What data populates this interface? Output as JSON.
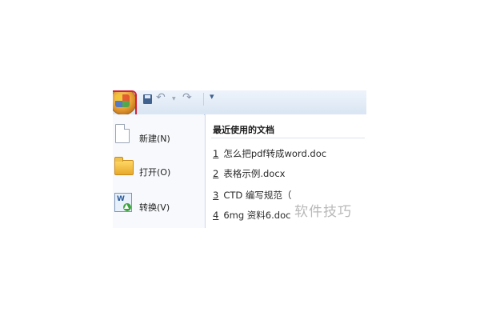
{
  "menu": {
    "items": [
      {
        "label": "新建(N)",
        "icon": "new-document-icon"
      },
      {
        "label": "打开(O)",
        "icon": "open-folder-icon"
      },
      {
        "label": "转换(V)",
        "icon": "convert-icon"
      }
    ]
  },
  "recent": {
    "title": "最近使用的文档",
    "items": [
      {
        "num": "1",
        "name": "怎么把pdf转成word.doc"
      },
      {
        "num": "2",
        "name": "表格示例.docx"
      },
      {
        "num": "3",
        "name": "CTD 编写规范（"
      },
      {
        "num": "4",
        "name": "6mg 资料6.doc"
      }
    ]
  },
  "quick_access": {
    "customize_glyph": "▾"
  },
  "convert_icon_letter": "W",
  "watermark": "软件技巧",
  "colors": {
    "highlight_border": "#d3223a",
    "toolbar_bg": "#d9e5f3",
    "office_button": "#e8a035"
  }
}
